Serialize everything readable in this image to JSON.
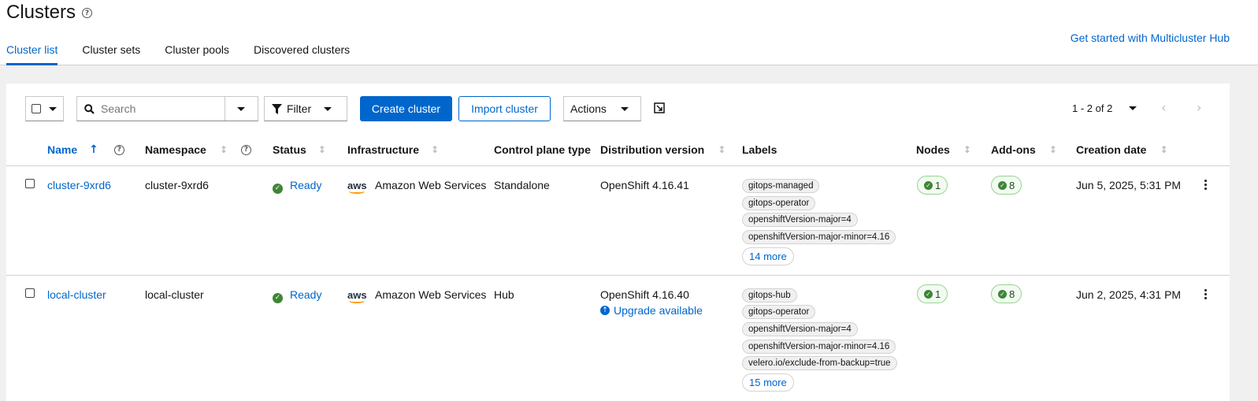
{
  "page": {
    "title": "Clusters",
    "get_started": "Get started with Multicluster Hub"
  },
  "tabs": [
    {
      "label": "Cluster list",
      "active": true
    },
    {
      "label": "Cluster sets",
      "active": false
    },
    {
      "label": "Cluster pools",
      "active": false
    },
    {
      "label": "Discovered clusters",
      "active": false
    }
  ],
  "toolbar": {
    "search_placeholder": "Search",
    "filter_label": "Filter",
    "create_label": "Create cluster",
    "import_label": "Import cluster",
    "actions_label": "Actions",
    "pagination": "1 - 2 of 2"
  },
  "columns": [
    "Name",
    "Namespace",
    "Status",
    "Infrastructure",
    "Control plane type",
    "Distribution version",
    "Labels",
    "Nodes",
    "Add-ons",
    "Creation date"
  ],
  "rows": [
    {
      "name": "cluster-9xrd6",
      "namespace": "cluster-9xrd6",
      "status": "Ready",
      "infra_logo": "aws",
      "infrastructure": "Amazon Web Services",
      "control_plane": "Standalone",
      "distribution": "OpenShift 4.16.41",
      "labels": [
        "gitops-managed",
        "gitops-operator",
        "openshiftVersion-major=4",
        "openshiftVersion-major-minor=4.16"
      ],
      "more": "14 more",
      "nodes": "1",
      "addons": "8",
      "created": "Jun 5, 2025, 5:31 PM"
    },
    {
      "name": "local-cluster",
      "namespace": "local-cluster",
      "status": "Ready",
      "infra_logo": "aws",
      "infrastructure": "Amazon Web Services",
      "control_plane": "Hub",
      "distribution": "OpenShift 4.16.40",
      "upgrade": "Upgrade available",
      "labels": [
        "gitops-hub",
        "gitops-operator",
        "openshiftVersion-major=4",
        "openshiftVersion-major-minor=4.16",
        "velero.io/exclude-from-backup=true"
      ],
      "more": "15 more",
      "nodes": "1",
      "addons": "8",
      "created": "Jun 2, 2025, 4:31 PM"
    }
  ],
  "colors": {
    "accent": "#0066cc",
    "success": "#3e8635"
  }
}
